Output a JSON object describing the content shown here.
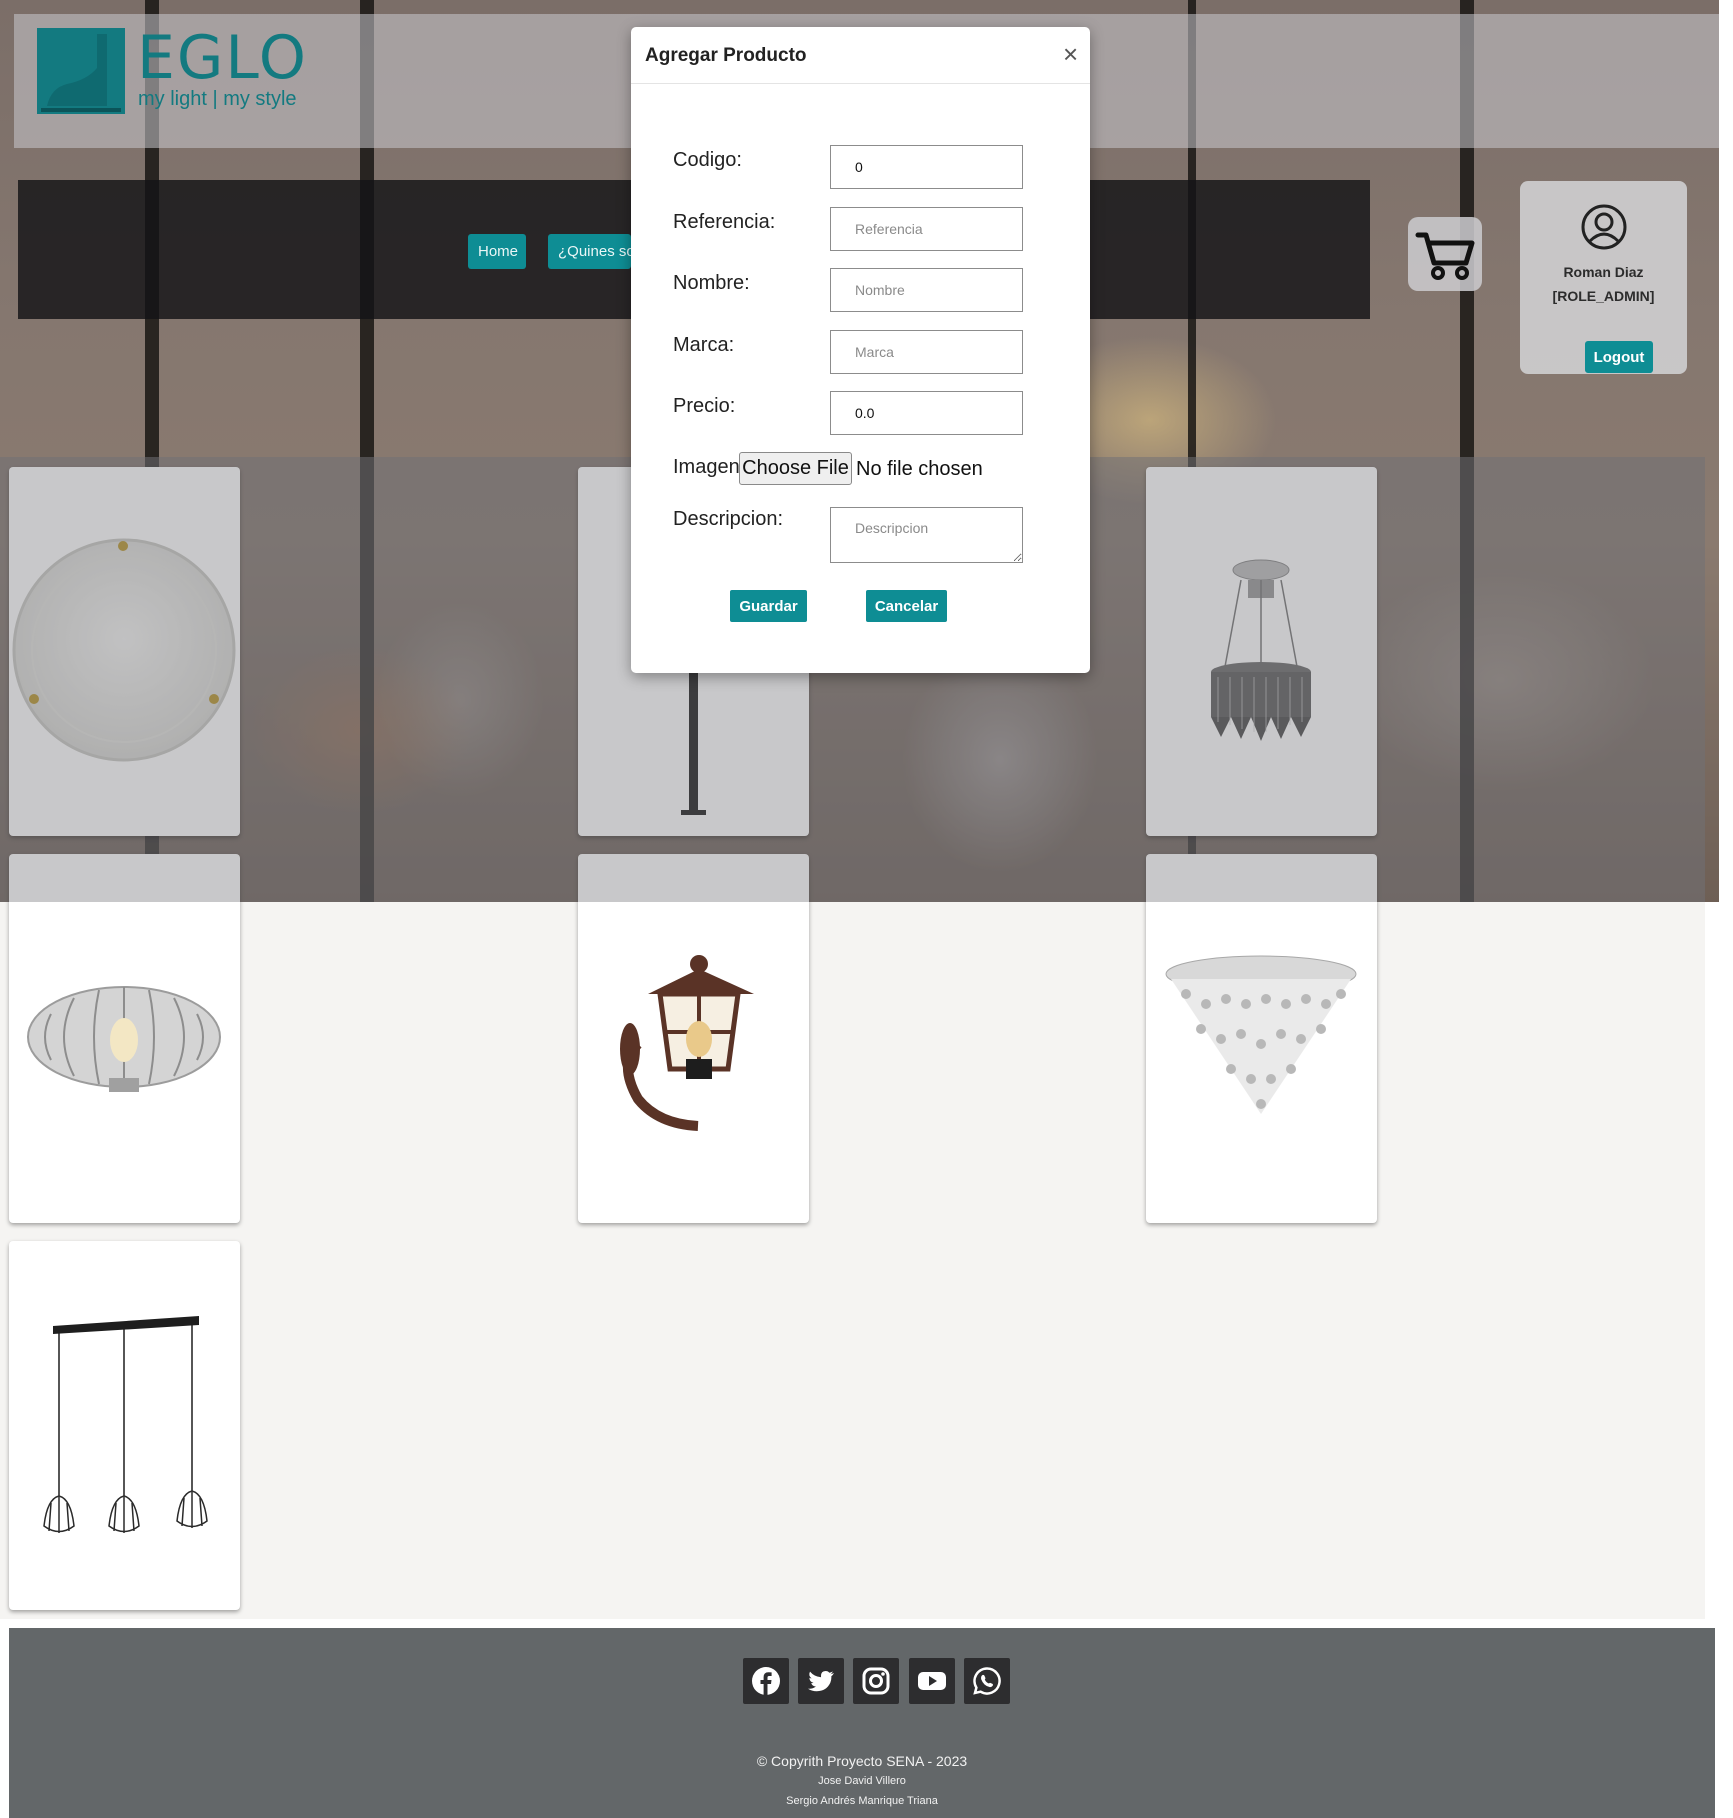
{
  "brand": {
    "name": "EGLO",
    "tagline": "my light | my style",
    "color": "#137a80"
  },
  "nav": {
    "items": [
      {
        "label": "Home"
      },
      {
        "label": "¿Quines somos?"
      }
    ]
  },
  "user": {
    "name": "Roman Diaz",
    "role": "[ROLE_ADMIN]",
    "logout_label": "Logout"
  },
  "products": [
    {
      "icon": "round-ceiling-lamp"
    },
    {
      "icon": "post-lamp"
    },
    {
      "icon": "crystal-chandelier"
    },
    {
      "icon": "wooden-pendant-lamp"
    },
    {
      "icon": "outdoor-wall-lantern"
    },
    {
      "icon": "crystal-ceiling-lamp"
    },
    {
      "icon": "triple-cage-pendant"
    }
  ],
  "footer": {
    "social": [
      "facebook-icon",
      "twitter-icon",
      "instagram-icon",
      "youtube-icon",
      "whatsapp-icon"
    ],
    "copyright": "© Copyrith Proyecto SENA - 2023",
    "author1": "Jose David Villero",
    "author2": "Sergio Andrés Manrique Triana"
  },
  "modal": {
    "title": "Agregar Producto",
    "close_symbol": "×",
    "fields": {
      "codigo": {
        "label": "Codigo:",
        "value": "0",
        "placeholder": ""
      },
      "referencia": {
        "label": "Referencia:",
        "value": "",
        "placeholder": "Referencia"
      },
      "nombre": {
        "label": "Nombre:",
        "value": "",
        "placeholder": "Nombre"
      },
      "marca": {
        "label": "Marca:",
        "value": "",
        "placeholder": "Marca"
      },
      "precio": {
        "label": "Precio:",
        "value": "0.0",
        "placeholder": ""
      },
      "imagen": {
        "label": "Imagen:",
        "button": "Choose File",
        "status": "No file chosen"
      },
      "descripcion": {
        "label": "Descripcion:",
        "placeholder": "Descripcion"
      }
    },
    "save_label": "Guardar",
    "cancel_label": "Cancelar"
  },
  "colors": {
    "accent": "#0e8d94",
    "footer": "#636769",
    "nav_bar": "#141416"
  }
}
